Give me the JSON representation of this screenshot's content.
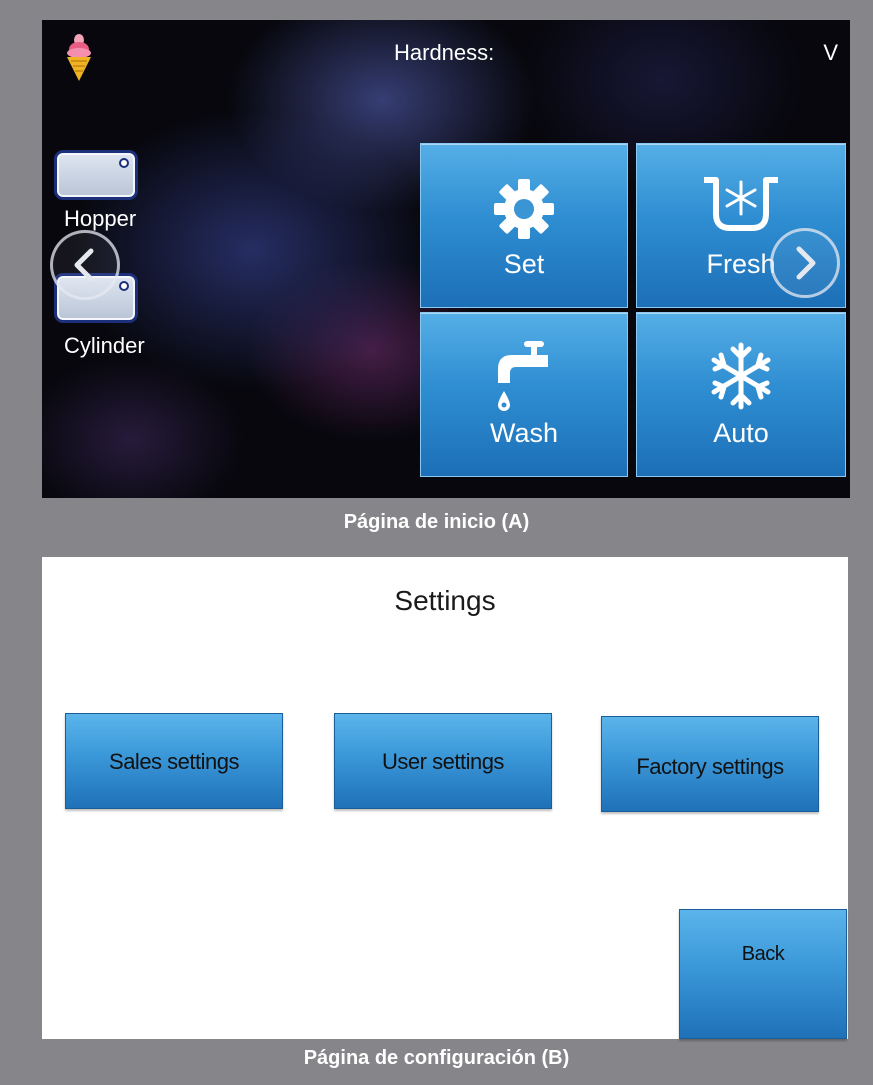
{
  "screen_a": {
    "hardness_label": "Hardness:",
    "hardness_value": "V",
    "hopper_label": "Hopper",
    "cylinder_label": "Cylinder",
    "tiles": [
      {
        "label": "Set",
        "icon": "gear-icon"
      },
      {
        "label": "Fresh",
        "icon": "fresh-snowflake-bowl-icon"
      },
      {
        "label": "Wash",
        "icon": "faucet-icon"
      },
      {
        "label": "Auto",
        "icon": "snowflake-icon"
      }
    ],
    "caption": "Página de inicio (A)"
  },
  "screen_b": {
    "title": "Settings",
    "buttons": {
      "sales": "Sales settings",
      "user": "User settings",
      "factory": "Factory settings",
      "back": "Back"
    },
    "caption": "Página de configuración (B)"
  },
  "colors": {
    "tile_blue": "#2f8ed2",
    "background_gray": "#86868a"
  }
}
